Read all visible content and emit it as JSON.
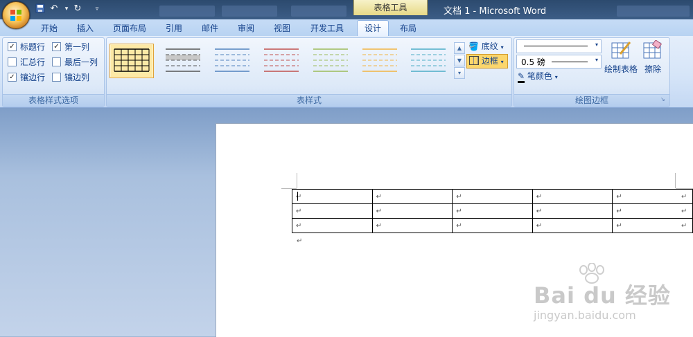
{
  "titlebar": {
    "window_title": "文档 1 - Microsoft Word",
    "context_tab": "表格工具",
    "qat": {
      "save_icon": "save-icon",
      "undo_icon": "undo-icon",
      "redo_icon": "redo-icon",
      "customize_icon": "chevron-down-icon"
    }
  },
  "tabs": [
    {
      "label": "开始"
    },
    {
      "label": "插入"
    },
    {
      "label": "页面布局"
    },
    {
      "label": "引用"
    },
    {
      "label": "邮件"
    },
    {
      "label": "审阅"
    },
    {
      "label": "视图"
    },
    {
      "label": "开发工具"
    },
    {
      "label": "设计",
      "active": true
    },
    {
      "label": "布局"
    }
  ],
  "style_options": {
    "group_label": "表格样式选项",
    "items": [
      {
        "label": "标题行",
        "checked": true
      },
      {
        "label": "第一列",
        "checked": true
      },
      {
        "label": "汇总行",
        "checked": false
      },
      {
        "label": "最后一列",
        "checked": false
      },
      {
        "label": "镶边行",
        "checked": true
      },
      {
        "label": "镶边列",
        "checked": false
      }
    ]
  },
  "table_styles": {
    "group_label": "表样式",
    "shading_label": "底纹",
    "borders_label": "边框",
    "swatch_colors": [
      "#000000",
      "#555555",
      "#4f81bd",
      "#c0504d",
      "#9bbb59",
      "#f2b441",
      "#4bacc6"
    ]
  },
  "draw_borders": {
    "group_label": "绘图边框",
    "line_weight": "0.5 磅",
    "pen_color_label": "笔颜色",
    "draw_table_label": "绘制表格",
    "eraser_label": "擦除"
  },
  "document": {
    "rows": 3,
    "cols": 5,
    "cell_mark": "↵"
  },
  "watermark": {
    "brand": "Bai du 经验",
    "url": "jingyan.baidu.com"
  },
  "colors": {
    "ribbon_text": "#15428b",
    "active_swatch": "#fde9a6"
  }
}
